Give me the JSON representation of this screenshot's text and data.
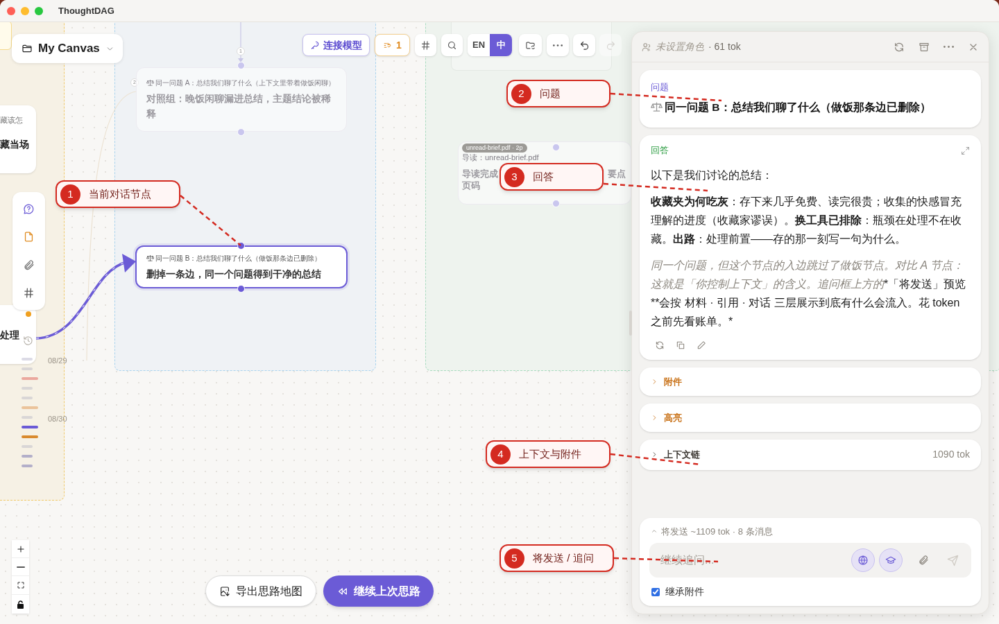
{
  "window": {
    "title": "ThoughtDAG"
  },
  "canvas_selector": {
    "label": "My Canvas"
  },
  "toolbar": {
    "connect_model": "连接模型",
    "pending_count": "1",
    "languages": [
      {
        "label": "EN",
        "selected": false
      },
      {
        "label": "中",
        "selected": true
      }
    ],
    "redo_disabled": true
  },
  "partial_nodes": [
    {
      "subtitle": "藏该怎",
      "title": "藏当场"
    },
    {
      "title": "处理"
    }
  ],
  "nodes": [
    {
      "kind": "faded",
      "question": "同一问题 A：总结我们聊了什么（上下文里带着做饭闲聊）",
      "title": "对照组：晚饭闲聊漏进总结，主题结论被稀释",
      "selected": false
    },
    {
      "kind": "chat",
      "question": "同一问题 B：总结我们聊了什么（做饭那条边已删除）",
      "title": "删掉一条边，同一个问题得到干净的总结",
      "selected": true
    },
    {
      "kind": "document",
      "file": "unread-brief.pdf · 2p",
      "question": "导读：unread-brief.pdf",
      "title": "导读完成",
      "title_tail": "要点",
      "title_line2": "页码",
      "selected": false
    }
  ],
  "edge_labels": [
    "1",
    "2"
  ],
  "timeline": {
    "dates": [
      "08/29",
      "08/30"
    ],
    "marks": [
      {
        "color": "#dcdbe6",
        "kind": "minor"
      },
      {
        "color": "#d9d6d6",
        "kind": "minor"
      },
      {
        "color": "#eba89e",
        "kind": "major"
      },
      {
        "color": "#d9d6d6",
        "kind": "minor"
      },
      {
        "color": "#d9d6d6",
        "kind": "minor"
      },
      {
        "color": "#ebc39a",
        "kind": "major"
      },
      {
        "color": "#d9d6d6",
        "kind": "minor"
      },
      {
        "color": "#6a5ad6",
        "kind": "major"
      },
      {
        "color": "#d98a2e",
        "kind": "major"
      },
      {
        "color": "#d9d6d6",
        "kind": "minor"
      },
      {
        "color": "#b3afc9",
        "kind": "minor"
      },
      {
        "color": "#b3afc9",
        "kind": "minor"
      }
    ]
  },
  "bottom_actions": [
    {
      "label": "导出思路地图",
      "kind": "secondary"
    },
    {
      "label": "继续上次思路",
      "kind": "primary"
    }
  ],
  "callouts": [
    {
      "number": "1",
      "label": "当前对话节点"
    },
    {
      "number": "2",
      "label": "问题"
    },
    {
      "number": "3",
      "label": "回答"
    },
    {
      "number": "4",
      "label": "上下文与附件"
    },
    {
      "number": "5",
      "label": "将发送 / 追问"
    }
  ],
  "panel": {
    "role": "未设置角色",
    "tokens": "· 61 tok",
    "question": {
      "label": "问题",
      "text": "同一问题 B：总结我们聊了什么（做饭那条边已删除）"
    },
    "answer": {
      "label": "回答",
      "intro": "以下是我们讨论的总结：",
      "summary": "**收藏夹为何吃灰**：存下来几乎免费、读完很贵；收集的快感冒充理解的进度（收藏家谬误）。**换工具已排除**：瓶颈在处理不在收藏。**出路**：处理前置——存的那一刻写一句为什么。",
      "note": {
        "emphasized": "同一个问题，但这个节点的入边跳过了做饭节点。对比 A 节点：这就是「你控制上下文」的含义。追问框上方的",
        "rest": "*「将发送」预览 **会按 材料 · 引用 · 对话 三层展示到底有什么会流入。花 token 之前先看账单。*"
      }
    },
    "sections": [
      {
        "label": "附件",
        "color": "#c9731a"
      },
      {
        "label": "高亮",
        "color": "#c9731a"
      },
      {
        "label": "上下文链",
        "color": "#3f3b36",
        "tokens": "1090 tok"
      }
    ],
    "composer": {
      "summary": "将发送 ~1109 tok · 8 条消息",
      "placeholder": "继续追问...",
      "web_search_on": true,
      "tutor_on": true,
      "send_disabled": true,
      "inherit_label": "继承附件",
      "inherit_checked": true
    }
  }
}
